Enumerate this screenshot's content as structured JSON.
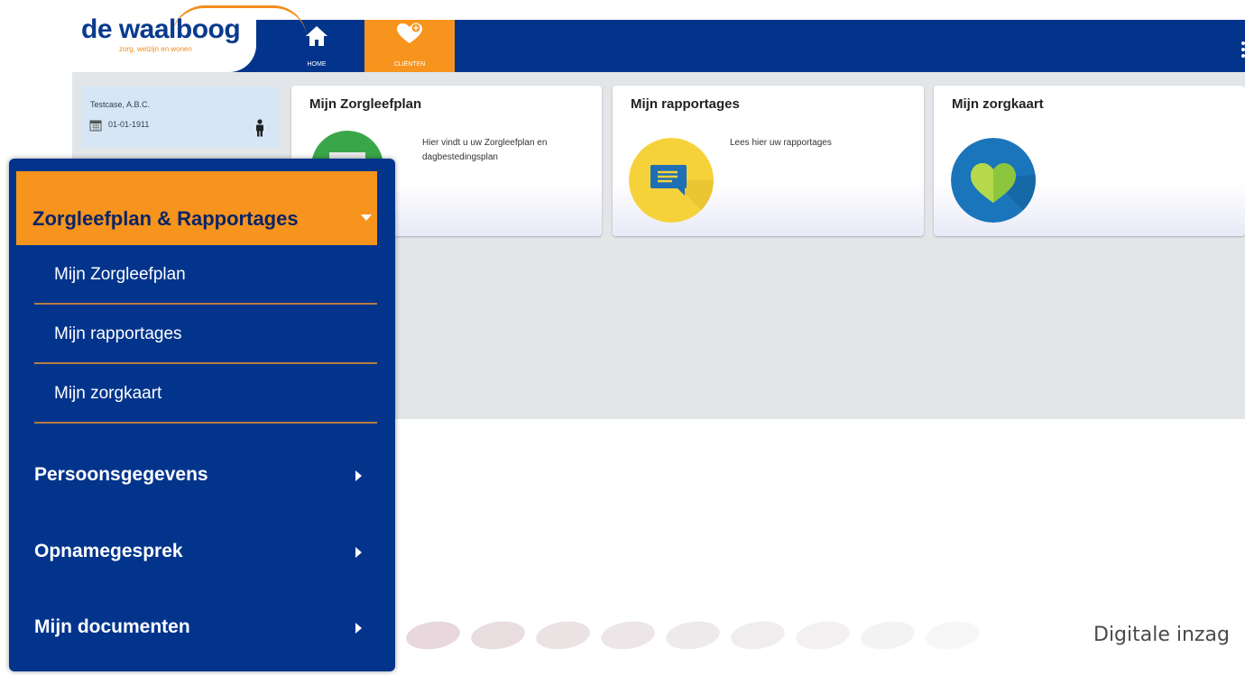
{
  "brand": {
    "name": "de waalboog",
    "tagline": "zorg, welzijn en wonen"
  },
  "nav": {
    "home_label": "HOME",
    "clienten_label": "CLIËNTEN",
    "active_color": "#f7941d",
    "bar_color": "#02348c"
  },
  "patient": {
    "name": "Testcase, A.B.C.",
    "dob": "01-01-1911"
  },
  "tiles": [
    {
      "title": "Mijn Zorgleefplan",
      "description": "Hier vindt u uw Zorgleefplan en dagbestedingsplan",
      "icon": "document-icon"
    },
    {
      "title": "Mijn rapportages",
      "description": "Lees hier uw rapportages",
      "icon": "chat-message-icon"
    },
    {
      "title": "Mijn zorgkaart",
      "description": "",
      "icon": "heart-icon"
    }
  ],
  "menu": {
    "header": "Zorgleefplan & Rapportages",
    "sub_items": [
      {
        "label": "Mijn Zorgleefplan"
      },
      {
        "label": "Mijn rapportages"
      },
      {
        "label": "Mijn zorgkaart"
      }
    ],
    "main_items": [
      {
        "label": "Persoonsgegevens"
      },
      {
        "label": "Opnamegesprek"
      },
      {
        "label": "Mijn documenten"
      }
    ]
  },
  "footer": {
    "text": "Digitale inzag"
  }
}
